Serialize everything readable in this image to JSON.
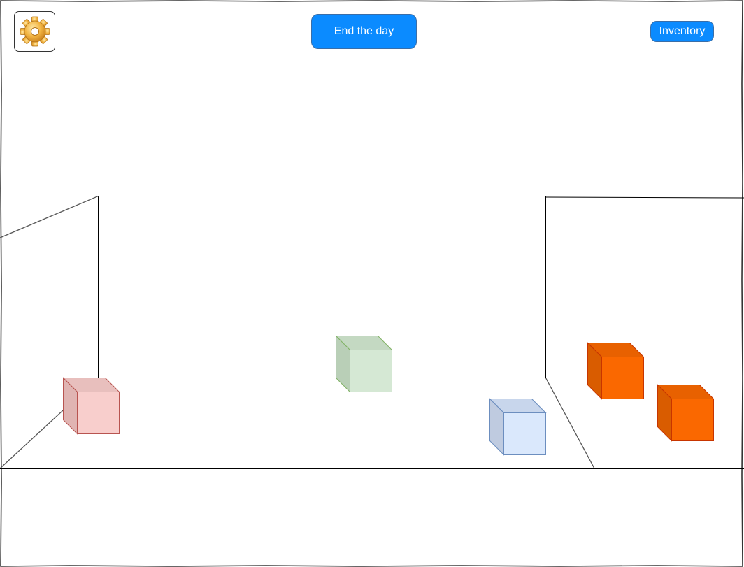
{
  "toolbar": {
    "settings_icon": "gear-icon",
    "end_day_label": "End the day",
    "inventory_label": "Inventory"
  },
  "colors": {
    "button_blue": "#0b8bff",
    "gear_gold": "#f2b441",
    "box_red_fill": "#f8cecc",
    "box_red_stroke": "#b85450",
    "box_green_fill": "#d5e8d4",
    "box_green_stroke": "#82b366",
    "box_blue_fill": "#dae8fc",
    "box_blue_stroke": "#6c8ebf",
    "box_orange_fill": "#fa6800",
    "box_orange_stroke": "#c73500"
  },
  "boxes": [
    {
      "name": "red-box",
      "color": "red"
    },
    {
      "name": "green-box",
      "color": "green"
    },
    {
      "name": "blue-box",
      "color": "blue"
    },
    {
      "name": "orange-box-1",
      "color": "orange"
    },
    {
      "name": "orange-box-2",
      "color": "orange"
    }
  ]
}
